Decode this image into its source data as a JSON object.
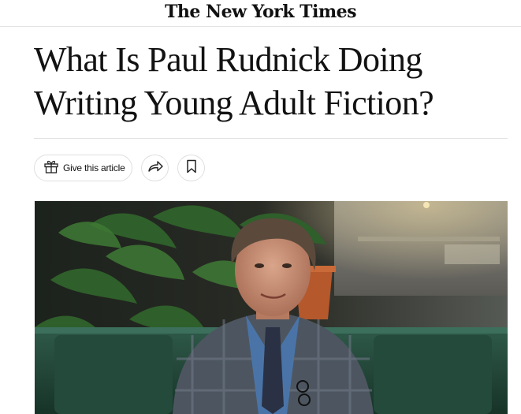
{
  "masthead": {
    "logo_text": "The New York Times"
  },
  "article": {
    "headline": "What Is Paul Rudnick Doing Writing Young Adult Fiction?"
  },
  "actions": {
    "gift_label": "Give this article",
    "share_icon": "share-arrow-icon",
    "save_icon": "bookmark-icon"
  },
  "photo": {
    "alt": "Portrait of Paul Rudnick seated in a green booth"
  }
}
